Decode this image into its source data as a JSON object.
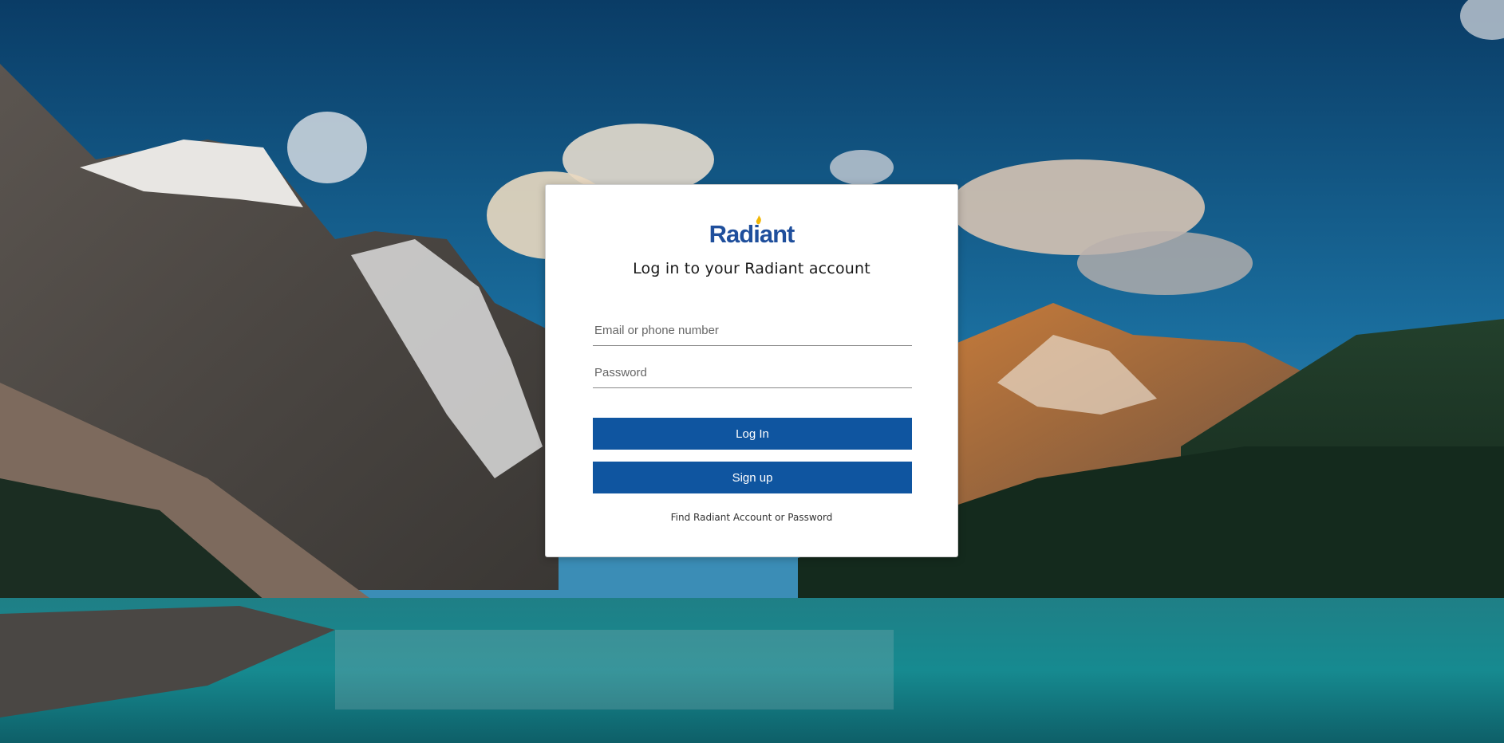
{
  "brand": {
    "logo_text": "Radiant",
    "primary_color": "#0f55a0",
    "logo_color": "#1f4f9c",
    "flame_color": "#f2b705"
  },
  "login": {
    "title": "Log in to your Radiant account",
    "email_placeholder": "Email or phone number",
    "email_value": "",
    "password_placeholder": "Password",
    "password_value": "",
    "login_button": "Log In",
    "signup_button": "Sign up",
    "find_account_link": "Find Radiant Account or Password"
  }
}
